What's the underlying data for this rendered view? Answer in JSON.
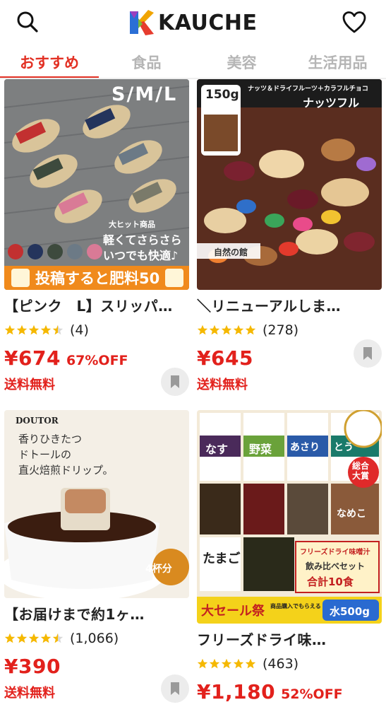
{
  "header": {
    "logo_text": "KAUCHE"
  },
  "tabs": [
    {
      "label": "おすすめ",
      "active": true
    },
    {
      "label": "食品",
      "active": false
    },
    {
      "label": "美容",
      "active": false
    },
    {
      "label": "生活用品",
      "active": false
    }
  ],
  "products": [
    {
      "title": "【ピンク　L】スリッパ…",
      "rating": 4.5,
      "review_count": "(4)",
      "price": "¥674",
      "discount": "67%OFF",
      "shipping": "送料無料",
      "image": {
        "size_label": "S/M/L",
        "badge_small": "大ヒット商品",
        "catch_1": "軽くてさらさら",
        "catch_2": "いつでも快適♪",
        "banner": "投稿すると肥料50"
      }
    },
    {
      "title": "＼リニューアルしま…",
      "rating": 5,
      "review_count": "(278)",
      "price": "¥645",
      "discount": "",
      "shipping": "送料無料",
      "image": {
        "weight": "150g",
        "top_text": "ナッツ＆ドライフルーツ＋カラフルチョコ",
        "brand_text": "ナッツフル",
        "shop_text": "自然の館"
      }
    },
    {
      "title": "【お届けまで約1ヶ…",
      "rating": 4.5,
      "review_count": "(1,066)",
      "price": "¥390",
      "discount": "",
      "shipping": "送料無料",
      "image": {
        "brand": "DOUTOR",
        "copy_1": "香りひきたつ",
        "copy_2": "ドトールの",
        "copy_3": "直火焙煎ドリップ。",
        "badge": "4杯分"
      }
    },
    {
      "title": "フリーズドライ味…",
      "rating": 5,
      "review_count": "(463)",
      "price": "¥1,180",
      "discount": "52%OFF",
      "shipping": "",
      "image": {
        "labels": [
          "なす",
          "野菜",
          "あさり",
          "とう",
          "なめこ",
          "たまご"
        ],
        "award": "総合大賞",
        "set_1": "フリーズドライ味噌汁",
        "set_2": "飲み比べセット",
        "set_3": "合計10食",
        "sale": "大セール祭",
        "sale_sub": "商品購入でもらえる",
        "sale_reward": "水500g"
      }
    }
  ],
  "colors": {
    "accent": "#e23124",
    "price": "#e2211c",
    "star": "#f5b800",
    "tab_inactive": "#b5b5b5"
  }
}
